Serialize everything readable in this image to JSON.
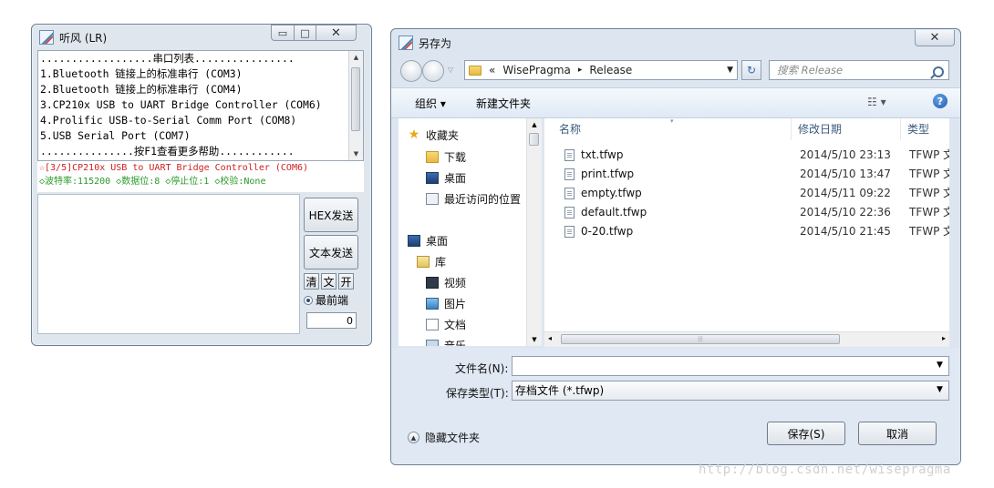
{
  "serial_window": {
    "title": "听风 (LR)",
    "caption": {
      "minimize": "▭",
      "maximize": "□",
      "close": "✕"
    },
    "port_list": [
      "..................串口列表................",
      "1.Bluetooth 链接上的标准串行 (COM3)",
      "2.Bluetooth 链接上的标准串行 (COM4)",
      "3.CP210x USB to UART Bridge Controller (COM6)",
      "4.Prolific USB-to-Serial Comm Port (COM8)",
      "5.USB Serial Port (COM7)",
      "...............按F1查看更多帮助............"
    ],
    "status_port": "☆[3/5]CP210x USB to UART Bridge Controller (COM6)",
    "status_params": "◇波特率:115200 ◇数据位:8 ◇停止位:1 ◇校验:None",
    "buttons": {
      "hex_send": "HEX发送",
      "text_send": "文本发送",
      "clear": "清",
      "text": "文",
      "open": "开"
    },
    "topmost_label": "最前端",
    "count": "0"
  },
  "save_dialog": {
    "title": "另存为",
    "close": "✕",
    "breadcrumb": {
      "prefix": "«",
      "parent": "WisePragma",
      "sep": "▸",
      "current": "Release"
    },
    "search_placeholder": "搜索 Release",
    "toolbar": {
      "organize": "组织 ▾",
      "new_folder": "新建文件夹",
      "views": "☷ ▾",
      "help": "?"
    },
    "nav_items": [
      {
        "label": "收藏夹",
        "icon": "star-icon"
      },
      {
        "label": "下载",
        "icon": "downloads-folder-icon"
      },
      {
        "label": "桌面",
        "icon": "desktop-icon"
      },
      {
        "label": "最近访问的位置",
        "icon": "recent-places-icon"
      },
      {
        "label": "桌面",
        "icon": "desktop-icon"
      },
      {
        "label": "库",
        "icon": "library-icon"
      },
      {
        "label": "视频",
        "icon": "video-icon"
      },
      {
        "label": "图片",
        "icon": "pictures-icon"
      },
      {
        "label": "文档",
        "icon": "documents-icon"
      },
      {
        "label": "音乐",
        "icon": "music-icon"
      }
    ],
    "columns": {
      "name": "名称",
      "date": "修改日期",
      "type": "类型"
    },
    "files": [
      {
        "name": "txt.tfwp",
        "date": "2014/5/10 23:13",
        "type": "TFWP 文件"
      },
      {
        "name": "print.tfwp",
        "date": "2014/5/10 13:47",
        "type": "TFWP 文件"
      },
      {
        "name": "empty.tfwp",
        "date": "2014/5/11 09:22",
        "type": "TFWP 文件"
      },
      {
        "name": "default.tfwp",
        "date": "2014/5/10 22:36",
        "type": "TFWP 文件"
      },
      {
        "name": "0-20.tfwp",
        "date": "2014/5/10 21:45",
        "type": "TFWP 文件"
      }
    ],
    "filename_label": "文件名(N):",
    "filename_value": "",
    "filetype_label": "保存类型(T):",
    "filetype_value": "存档文件 (*.tfwp)",
    "hide_folders": "隐藏文件夹",
    "save_button": "保存(S)",
    "cancel_button": "取消"
  },
  "watermark": "http://blog.csdn.net/wisepragma"
}
